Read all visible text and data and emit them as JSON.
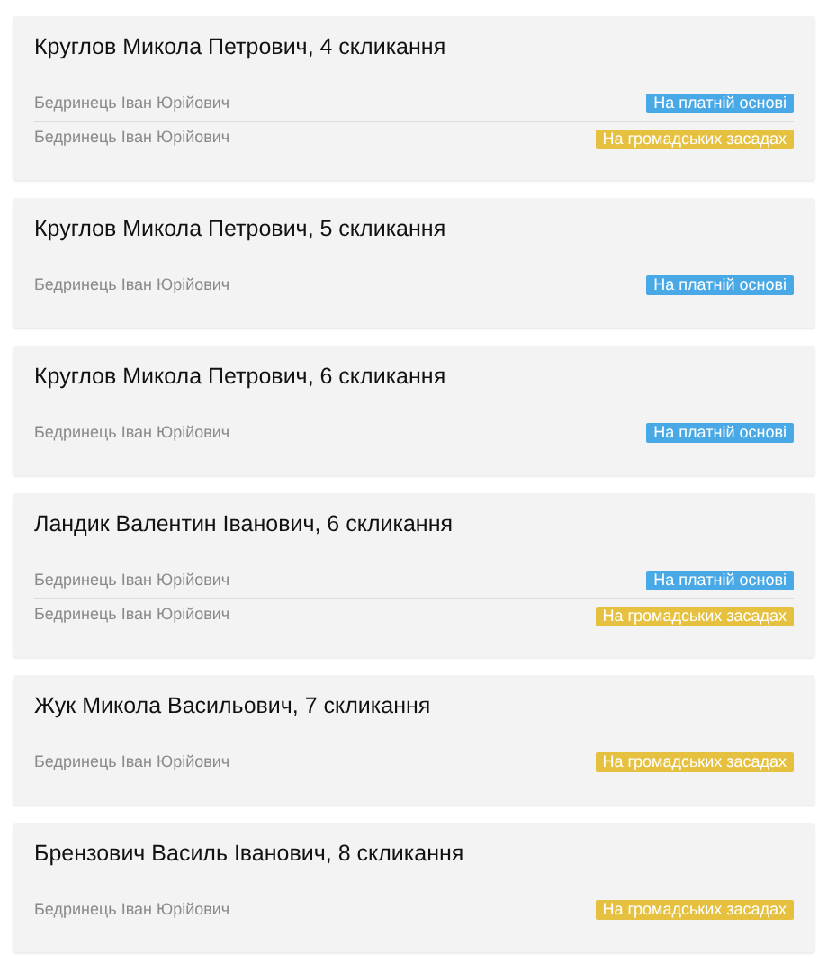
{
  "cards": [
    {
      "title": "Круглов Микола Петрович, 4 скликання",
      "rows": [
        {
          "name": "Бедринець Іван Юрійович",
          "badge": "На платній основі",
          "color": "#48a9e6"
        },
        {
          "name": "Бедринець Іван Юрійович",
          "badge": "На громадських засадах",
          "color": "#e6c140"
        }
      ]
    },
    {
      "title": "Круглов Микола Петрович, 5 скликання",
      "rows": [
        {
          "name": "Бедринець Іван Юрійович",
          "badge": "На платній основі",
          "color": "#48a9e6"
        }
      ]
    },
    {
      "title": "Круглов Микола Петрович, 6 скликання",
      "rows": [
        {
          "name": "Бедринець Іван Юрійович",
          "badge": "На платній основі",
          "color": "#48a9e6"
        }
      ]
    },
    {
      "title": "Ландик Валентин Іванович, 6 скликання",
      "rows": [
        {
          "name": "Бедринець Іван Юрійович",
          "badge": "На платній основі",
          "color": "#48a9e6"
        },
        {
          "name": "Бедринець Іван Юрійович",
          "badge": "На громадських засадах",
          "color": "#e6c140"
        }
      ]
    },
    {
      "title": "Жук Микола Васильович, 7 скликання",
      "rows": [
        {
          "name": "Бедринець Іван Юрійович",
          "badge": "На громадських засадах",
          "color": "#e6c140"
        }
      ]
    },
    {
      "title": "Брензович Василь Іванович, 8 скликання",
      "rows": [
        {
          "name": "Бедринець Іван Юрійович",
          "badge": "На громадських засадах",
          "color": "#e6c140"
        }
      ]
    }
  ]
}
